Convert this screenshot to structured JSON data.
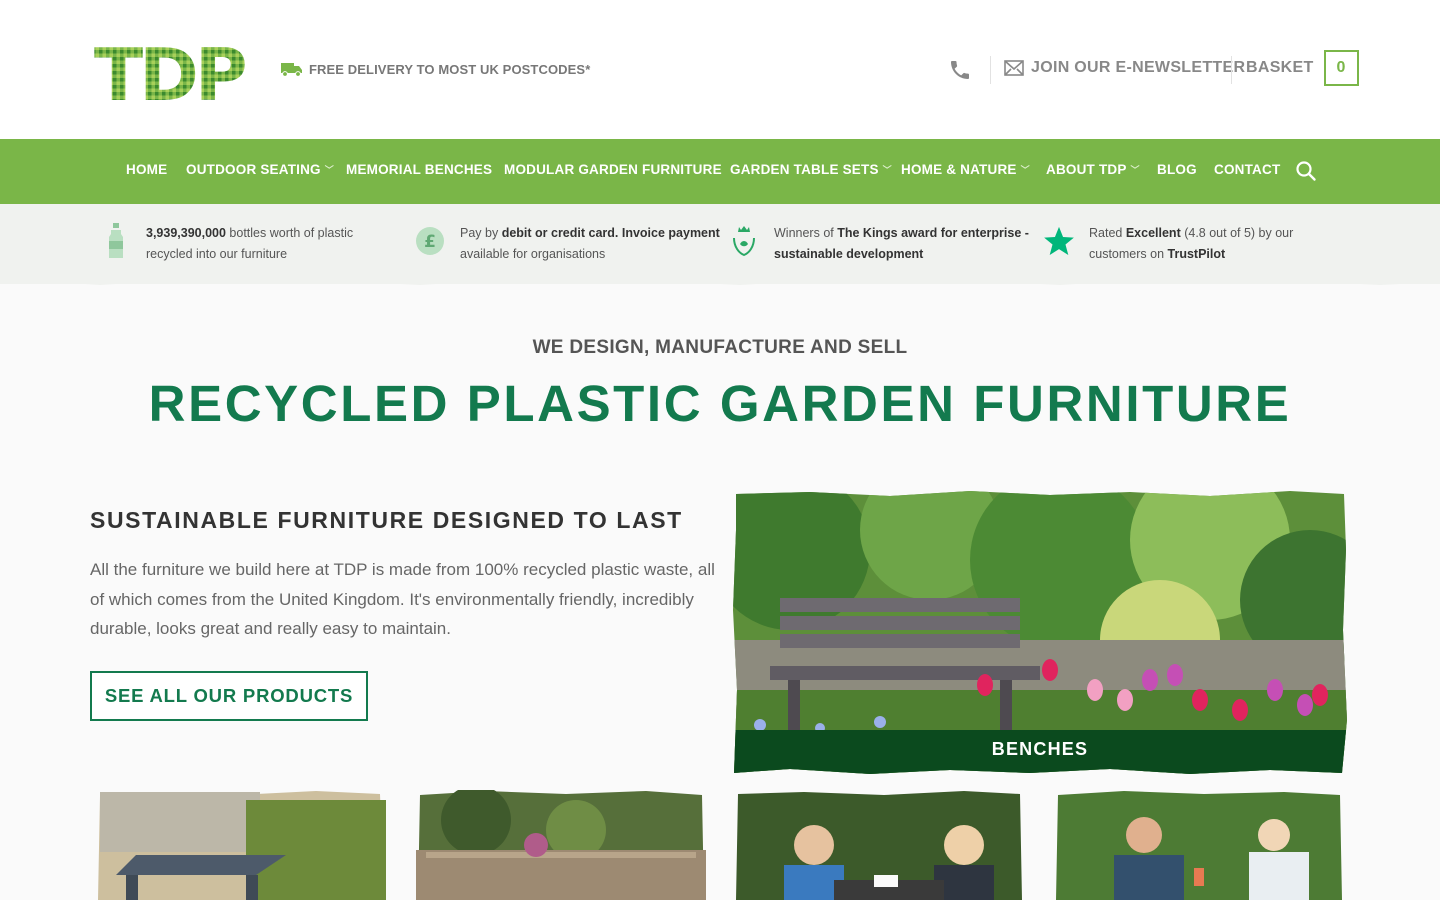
{
  "header": {
    "logo_text": "TDP",
    "delivery_text": "FREE DELIVERY TO MOST UK POSTCODES*",
    "newsletter_label": "JOIN OUR E-NEWSLETTER",
    "basket_label": "BASKET",
    "basket_count": "0"
  },
  "nav": {
    "items": [
      {
        "label": "HOME",
        "dropdown": false
      },
      {
        "label": "OUTDOOR SEATING",
        "dropdown": true
      },
      {
        "label": "MEMORIAL BENCHES",
        "dropdown": false
      },
      {
        "label": "MODULAR GARDEN FURNITURE",
        "dropdown": false
      },
      {
        "label": "GARDEN TABLE SETS",
        "dropdown": true
      },
      {
        "label": "HOME & NATURE",
        "dropdown": true
      },
      {
        "label": "ABOUT TDP",
        "dropdown": true
      },
      {
        "label": "BLOG",
        "dropdown": false
      },
      {
        "label": "CONTACT",
        "dropdown": false
      }
    ],
    "chevron": "﹀"
  },
  "info": [
    {
      "icon": "bottle-icon",
      "bold1": "3,939,390,000",
      "text1": " bottles worth of plastic",
      "line2": "recycled into our furniture"
    },
    {
      "icon": "pound-icon",
      "pre": "Pay by ",
      "bold1": "debit or credit card. Invoice payment",
      "line2": "available for organisations"
    },
    {
      "icon": "kings-award-icon",
      "pre": "Winners of ",
      "bold1": "The Kings award for enterprise -",
      "line2bold": "sustainable development"
    },
    {
      "icon": "trustpilot-star-icon",
      "pre": "Rated ",
      "bold1": "Excellent",
      "text1": " (4.8 out of 5) by our",
      "line2pre": "customers on ",
      "line2bold": "TrustPilot"
    }
  ],
  "hero": {
    "kicker": "WE DESIGN, MANUFACTURE AND SELL",
    "title": "RECYCLED PLASTIC GARDEN FURNITURE"
  },
  "intro": {
    "heading": "SUSTAINABLE FURNITURE DESIGNED TO LAST",
    "paragraph": "All the furniture we build here at TDP is made from 100% recycled plastic waste, all of which comes from the United Kingdom. It's environmentally friendly, incredibly durable, looks great and really easy to maintain.",
    "button_label": "SEE ALL OUR PRODUCTS"
  },
  "featured": {
    "label": "BENCHES"
  },
  "colors": {
    "brand_green": "#7ab648",
    "title_green": "#137a4e",
    "label_dark_green": "#0b4a1e"
  }
}
